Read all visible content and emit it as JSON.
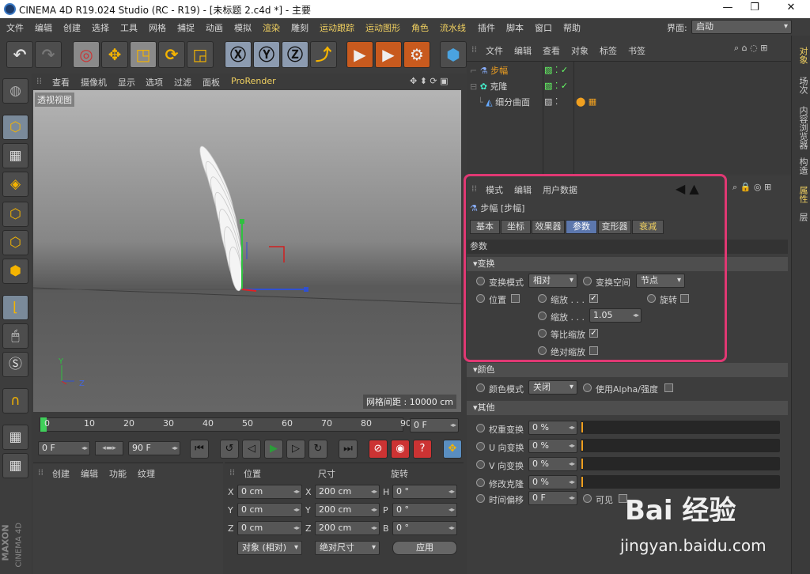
{
  "window": {
    "title": "CINEMA 4D R19.024 Studio (RC - R19) - [未标题 2.c4d *] - 主要",
    "min": "—",
    "max": "❐",
    "close": "✕"
  },
  "menu": [
    "文件",
    "编辑",
    "创建",
    "选择",
    "工具",
    "网格",
    "捕捉",
    "动画",
    "模拟",
    "渲染",
    "雕刻",
    "运动跟踪",
    "运动图形",
    "角色",
    "流水线",
    "插件",
    "脚本",
    "窗口",
    "帮助"
  ],
  "layout": {
    "label": "界面:",
    "value": "启动"
  },
  "viewport": {
    "menu": [
      "查看",
      "摄像机",
      "显示",
      "选项",
      "过滤",
      "面板",
      "ProRender"
    ],
    "label": "透视视图",
    "grid": "网格间距 : 10000 cm",
    "axis_y": "Y",
    "axis_z": "Z"
  },
  "timeline": {
    "ticks": [
      "0",
      "10",
      "20",
      "30",
      "40",
      "50",
      "60",
      "70",
      "80",
      "90"
    ],
    "frame": "0 F"
  },
  "transport": {
    "start": "0 F",
    "end": "90 F"
  },
  "materials": {
    "menu": [
      "创建",
      "编辑",
      "功能",
      "纹理"
    ]
  },
  "coords": {
    "headers": [
      "位置",
      "尺寸",
      "旋转"
    ],
    "rows": [
      {
        "a": "X",
        "pos": "0 cm",
        "b": "X",
        "size": "200 cm",
        "c": "H",
        "rot": "0 °"
      },
      {
        "a": "Y",
        "pos": "0 cm",
        "b": "Y",
        "size": "200 cm",
        "c": "P",
        "rot": "0 °"
      },
      {
        "a": "Z",
        "pos": "0 cm",
        "b": "Z",
        "size": "200 cm",
        "c": "B",
        "rot": "0 °"
      }
    ],
    "mode": "对象 (相对)",
    "size_mode": "绝对尺寸",
    "apply": "应用"
  },
  "objects": {
    "menu": [
      "文件",
      "编辑",
      "查看",
      "对象",
      "标签",
      "书签"
    ],
    "items": [
      "步幅",
      "克隆",
      "细分曲面"
    ]
  },
  "attributes": {
    "menu": [
      "模式",
      "编辑",
      "用户数据"
    ],
    "object": "步幅 [步幅]",
    "tabs": [
      "基本",
      "坐标",
      "效果器",
      "参数",
      "变形器",
      "衰减"
    ],
    "params_title": "参数",
    "transform": {
      "title": "变换",
      "mode_label": "变换模式",
      "mode_value": "相对",
      "space_label": "变换空间",
      "space_value": "节点",
      "position": "位置",
      "scale": "缩放 . . .",
      "rotate": "旋转",
      "scale2": "缩放 . . .",
      "scale_value": "1.05",
      "uniform": "等比缩放",
      "absolute": "绝对缩放"
    },
    "color": {
      "title": "颜色",
      "mode_label": "颜色模式",
      "mode_value": "关闭",
      "alpha": "使用Alpha/强度"
    },
    "other": {
      "title": "其他",
      "rows": [
        {
          "label": "权重变换",
          "value": "0 %"
        },
        {
          "label": "U 向变换",
          "value": "0 %"
        },
        {
          "label": "V 向变换",
          "value": "0 %"
        },
        {
          "label": "修改克隆",
          "value": "0 %"
        }
      ],
      "time_label": "时间偏移",
      "time_value": "0 F",
      "visible": "可见"
    }
  },
  "side_tabs": [
    "对象",
    "场次",
    "内容浏览器",
    "构造"
  ],
  "attr_tabs": [
    "属性",
    "层"
  ],
  "brand": {
    "maxon": "MAXON",
    "c4d": "CINEMA 4D"
  },
  "watermark": {
    "logo": "Bai 经验",
    "url": "jingyan.baidu.com"
  }
}
